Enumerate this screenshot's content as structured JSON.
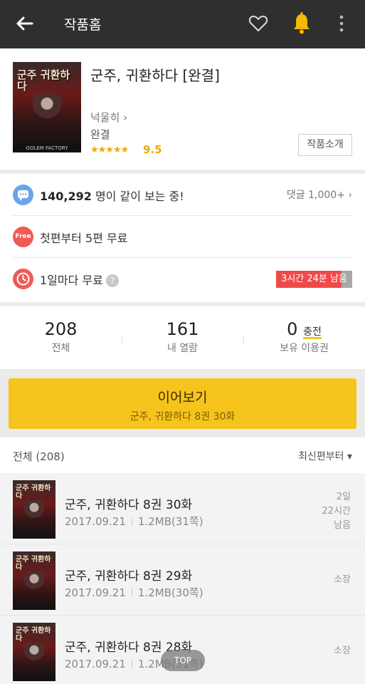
{
  "topbar": {
    "title": "작품홈",
    "icons": [
      "back-arrow-icon",
      "heart-icon",
      "bell-icon",
      "more-vertical-icon"
    ]
  },
  "work": {
    "cover_text": "군주 귀환하다",
    "cover_brand": "GOLEM FACTORY",
    "title": "군주, 귀환하다 [완결]",
    "author": "넉울히",
    "status": "완결",
    "stars": "★★★★★",
    "rating": "9.5",
    "intro_button": "작품소개"
  },
  "stats": {
    "viewers_count": "140,292",
    "viewers_suffix": " 명이 같이 보는 중!",
    "comments": "댓글 1,000+",
    "free_badge": "Free",
    "free_text": "첫편부터 5편 무료",
    "daily_text": "1일마다 무료",
    "help_glyph": "?",
    "timer_text": "3시간 24분 남음",
    "timer_remaining_fraction": 0.86
  },
  "counts": {
    "total_num": "208",
    "total_label": "전체",
    "read_num": "161",
    "read_label": "내 열람",
    "ticket_num": "0",
    "ticket_charge": "충전",
    "ticket_label": "보유 이용권"
  },
  "continue": {
    "label": "이어보기",
    "episode": "군주, 귀환하다 8권 30화"
  },
  "list": {
    "count_label": "전체 (208)",
    "sort_label": "최신편부터 ▾",
    "episodes": [
      {
        "title": "군주, 귀환하다 8권 30화",
        "date": "2017.09.21",
        "size": "1.2MB(31쪽)",
        "right": "2일\n22시간\n남음"
      },
      {
        "title": "군주, 귀환하다 8권 29화",
        "date": "2017.09.21",
        "size": "1.2MB(30쪽)",
        "right": "소장"
      },
      {
        "title": "군주, 귀환하다 8권 28화",
        "date": "2017.09.21",
        "size": "1.2MB(31쪽)",
        "right": "소장"
      }
    ]
  },
  "fab": {
    "label": "TOP"
  },
  "colors": {
    "accent_yellow": "#f6c41d",
    "topbar_bg": "#2f2f2f",
    "red": "#ef4a4a",
    "rating_orange": "#f0a800"
  }
}
